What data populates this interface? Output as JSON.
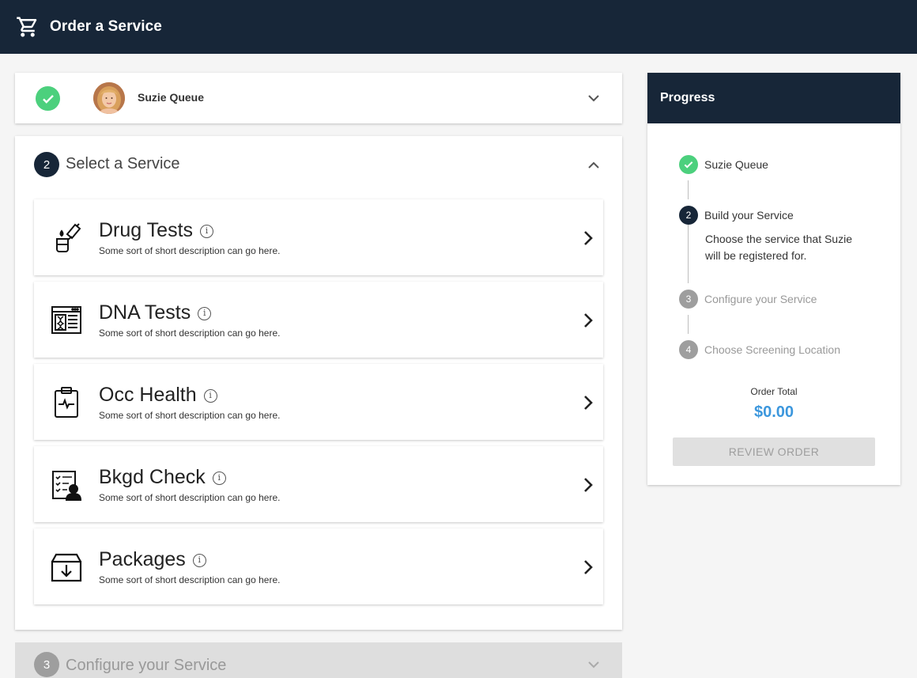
{
  "header": {
    "title": "Order a Service",
    "icon": "cart-icon"
  },
  "step1": {
    "name": "Suzie Queue",
    "status": "complete"
  },
  "step2": {
    "number": "2",
    "heading": "Select a Service",
    "services": [
      {
        "title": "Drug Tests",
        "description": "Some sort of short description can go here.",
        "icon": "drug-test-icon"
      },
      {
        "title": "DNA Tests",
        "description": "Some sort of short description can go here.",
        "icon": "dna-test-icon"
      },
      {
        "title": "Occ Health",
        "description": "Some sort of short description can go here.",
        "icon": "clipboard-health-icon"
      },
      {
        "title": "Bkgd Check",
        "description": "Some sort of short description can go here.",
        "icon": "background-check-icon"
      },
      {
        "title": "Packages",
        "description": "Some sort of short description can go here.",
        "icon": "package-icon"
      }
    ]
  },
  "step3": {
    "number": "3",
    "heading": "Configure your Service"
  },
  "progress": {
    "title": "Progress",
    "steps": [
      {
        "label": "Suzie Queue",
        "state": "done"
      },
      {
        "number": "2",
        "label": "Build your Service",
        "state": "active",
        "description": "Choose the service that Suzie will be registered for."
      },
      {
        "number": "3",
        "label": "Configure your Service",
        "state": "pending"
      },
      {
        "number": "4",
        "label": "Choose Screening Location",
        "state": "pending"
      }
    ],
    "total_label": "Order Total",
    "total_value": "$0.00",
    "review_button": "REVIEW ORDER"
  },
  "colors": {
    "navy": "#172638",
    "success": "#4cd07d",
    "accent": "#3c97dd",
    "pending": "#9e9e9e"
  }
}
